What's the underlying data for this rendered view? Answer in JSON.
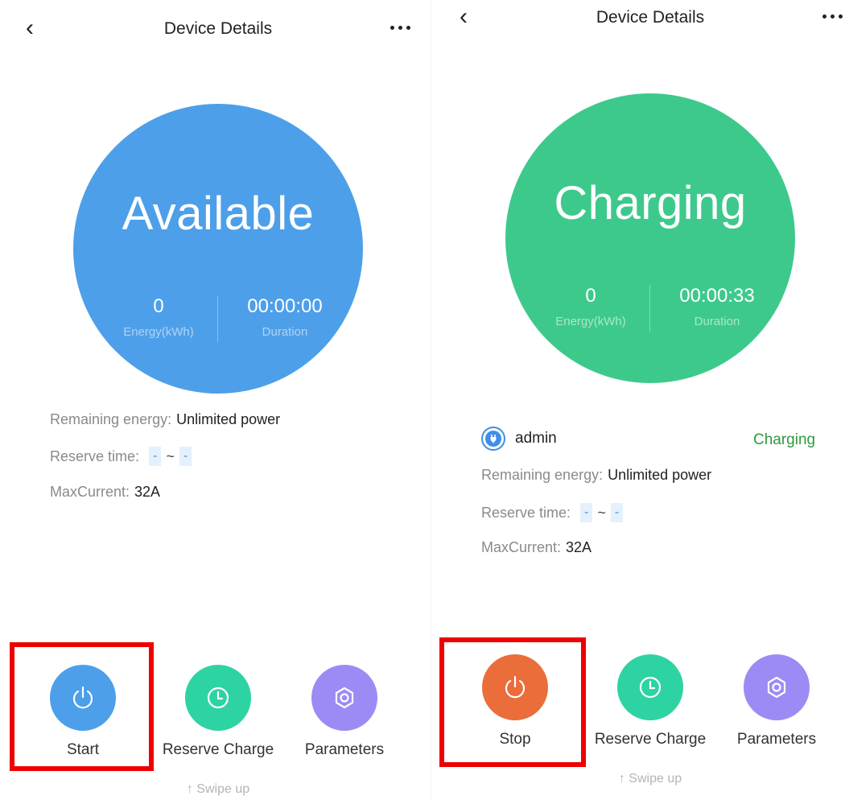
{
  "colors": {
    "available": "#4d9fe9",
    "charging": "#3ec98c",
    "start_button": "#4d9fe9",
    "stop_button": "#ea6d3a",
    "reserve_button": "#2ed3a3",
    "params_button": "#9c8bf4",
    "highlight": "#ee0000",
    "status_text": "#2e9a3e"
  },
  "screens": [
    {
      "header": {
        "back_icon": "chevron-left-icon",
        "title": "Device Details",
        "more_icon": "more-horizontal-icon"
      },
      "status": {
        "label": "Available",
        "energy_value": "0",
        "energy_label": "Energy(kWh)",
        "duration_value": "00:00:00",
        "duration_label": "Duration"
      },
      "info": {
        "remaining_label": "Remaining energy:",
        "remaining_value": "Unlimited power",
        "reserve_label": "Reserve time:",
        "reserve_start": "-",
        "reserve_sep": "~",
        "reserve_end": "-",
        "max_label": "MaxCurrent:",
        "max_value": "32A"
      },
      "actions": [
        {
          "label": "Start",
          "icon": "power-icon",
          "highlighted": true
        },
        {
          "label": "Reserve Charge",
          "icon": "clock-icon"
        },
        {
          "label": "Parameters",
          "icon": "gear-icon"
        }
      ],
      "swipe_hint": "↑ Swipe up"
    },
    {
      "header": {
        "back_icon": "chevron-left-icon",
        "title": "Device Details",
        "more_icon": "more-horizontal-icon"
      },
      "status": {
        "label": "Charging",
        "energy_value": "0",
        "energy_label": "Energy(kWh)",
        "duration_value": "00:00:33",
        "duration_label": "Duration"
      },
      "user": {
        "icon": "charging-plug-icon",
        "name": "admin",
        "status": "Charging"
      },
      "info": {
        "remaining_label": "Remaining energy:",
        "remaining_value": "Unlimited power",
        "reserve_label": "Reserve time:",
        "reserve_start": "-",
        "reserve_sep": "~",
        "reserve_end": "-",
        "max_label": "MaxCurrent:",
        "max_value": "32A"
      },
      "actions": [
        {
          "label": "Stop",
          "icon": "power-icon",
          "highlighted": true
        },
        {
          "label": "Reserve Charge",
          "icon": "clock-icon"
        },
        {
          "label": "Parameters",
          "icon": "gear-icon"
        }
      ],
      "swipe_hint": "↑ Swipe up"
    }
  ]
}
